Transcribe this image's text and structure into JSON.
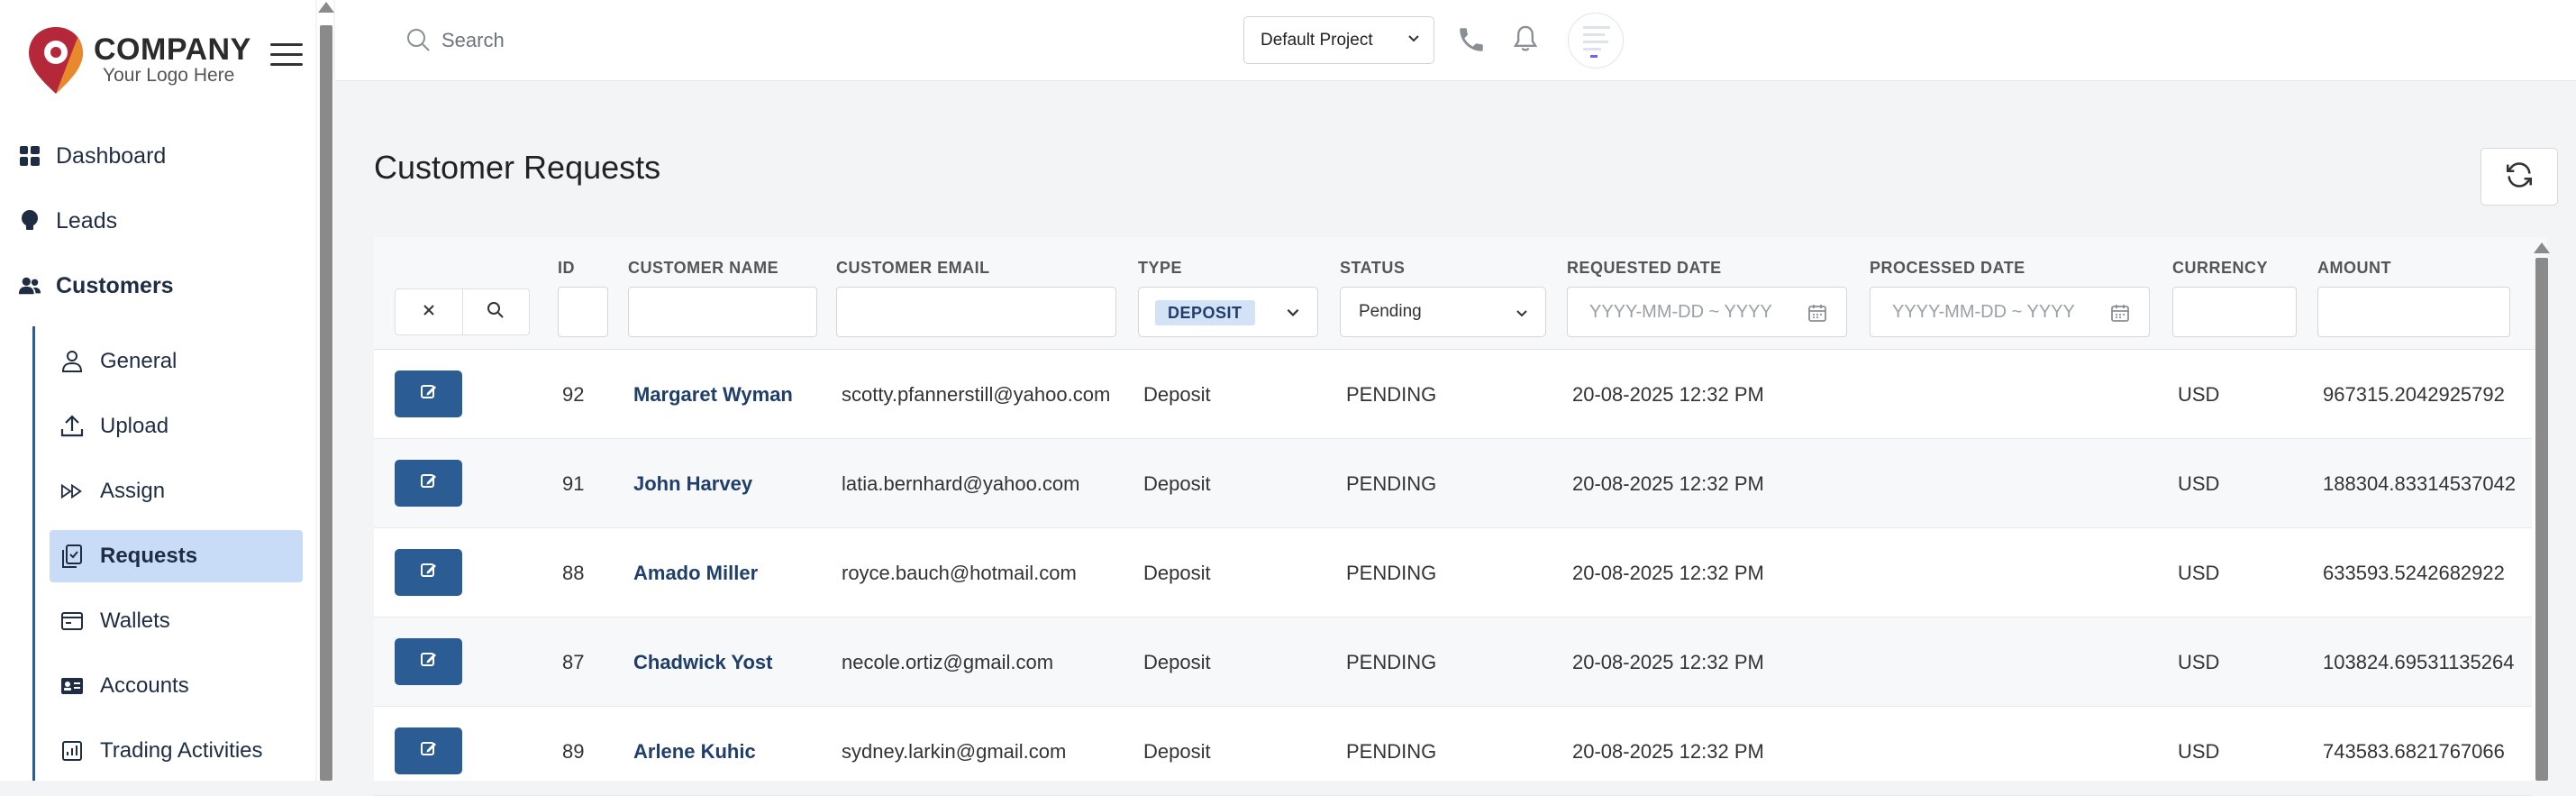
{
  "brand": {
    "name": "COMPANY",
    "tagline": "Your Logo Here"
  },
  "sidebar": {
    "items": [
      {
        "label": "Dashboard",
        "icon": "dashboard-grid-icon"
      },
      {
        "label": "Leads",
        "icon": "lightbulb-icon"
      },
      {
        "label": "Customers",
        "icon": "users-icon"
      }
    ],
    "sub_items": [
      {
        "label": "General",
        "icon": "user-icon"
      },
      {
        "label": "Upload",
        "icon": "upload-icon"
      },
      {
        "label": "Assign",
        "icon": "assign-forward-icon"
      },
      {
        "label": "Requests",
        "icon": "requests-icon"
      },
      {
        "label": "Wallets",
        "icon": "wallet-icon"
      },
      {
        "label": "Accounts",
        "icon": "id-card-icon"
      },
      {
        "label": "Trading Activities",
        "icon": "chart-icon"
      }
    ]
  },
  "topbar": {
    "search_placeholder": "Search",
    "project": "Default Project"
  },
  "page": {
    "title": "Customer Requests"
  },
  "table": {
    "columns": [
      "ID",
      "CUSTOMER NAME",
      "CUSTOMER EMAIL",
      "TYPE",
      "STATUS",
      "REQUESTED DATE",
      "PROCESSED DATE",
      "CURRENCY",
      "AMOUNT"
    ],
    "filters": {
      "type": "DEPOSIT",
      "status": "Pending",
      "requested_date_placeholder": "YYYY-MM-DD ~ YYYY",
      "processed_date_placeholder": "YYYY-MM-DD ~ YYYY"
    },
    "rows": [
      {
        "id": "92",
        "name": "Margaret Wyman",
        "email": "scotty.pfannerstill@yahoo.com",
        "type": "Deposit",
        "status": "PENDING",
        "requested": "20-08-2025 12:32 PM",
        "processed": "",
        "currency": "USD",
        "amount": "967315.2042925792"
      },
      {
        "id": "91",
        "name": "John Harvey",
        "email": "latia.bernhard@yahoo.com",
        "type": "Deposit",
        "status": "PENDING",
        "requested": "20-08-2025 12:32 PM",
        "processed": "",
        "currency": "USD",
        "amount": "188304.83314537042"
      },
      {
        "id": "88",
        "name": "Amado Miller",
        "email": "royce.bauch@hotmail.com",
        "type": "Deposit",
        "status": "PENDING",
        "requested": "20-08-2025 12:32 PM",
        "processed": "",
        "currency": "USD",
        "amount": "633593.5242682922"
      },
      {
        "id": "87",
        "name": "Chadwick Yost",
        "email": "necole.ortiz@gmail.com",
        "type": "Deposit",
        "status": "PENDING",
        "requested": "20-08-2025 12:32 PM",
        "processed": "",
        "currency": "USD",
        "amount": "103824.69531135264"
      },
      {
        "id": "89",
        "name": "Arlene Kuhic",
        "email": "sydney.larkin@gmail.com",
        "type": "Deposit",
        "status": "PENDING",
        "requested": "20-08-2025 12:32 PM",
        "processed": "",
        "currency": "USD",
        "amount": "743583.6821767066"
      }
    ]
  },
  "colors": {
    "accent": "#2c5c94",
    "active_bg": "#c9dcf7",
    "chip_bg": "#d4e2f6",
    "logo_red": "#b5283a",
    "logo_orange": "#e88a2c"
  }
}
